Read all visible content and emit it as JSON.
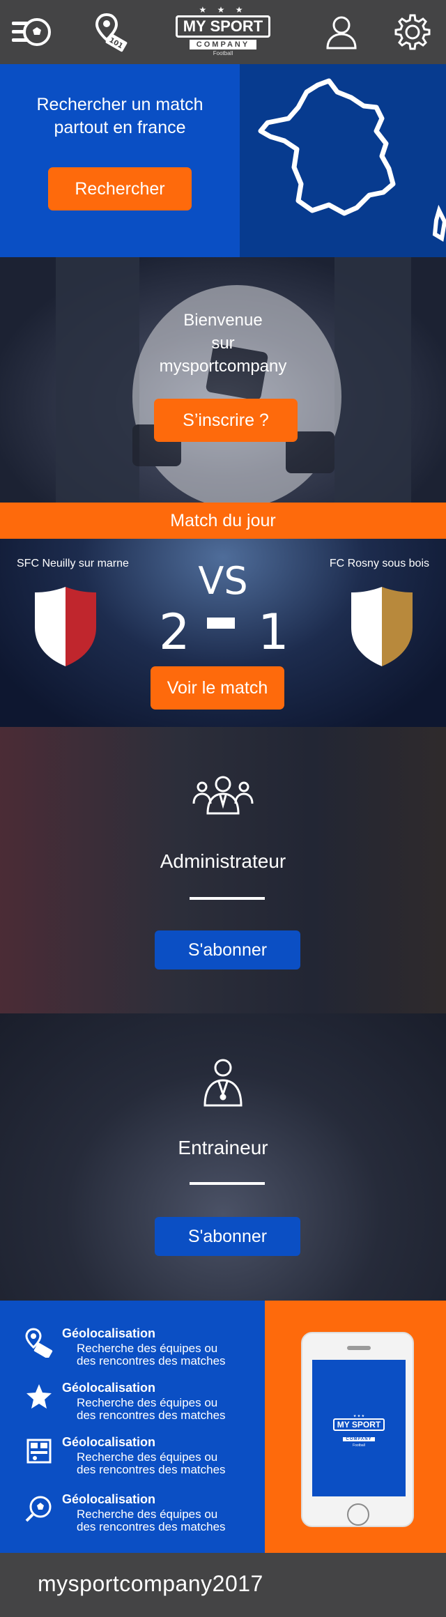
{
  "header": {
    "logo": {
      "stars": "★ ★ ★",
      "name": "MY SPORT",
      "company": "COMPANY",
      "sub": "Football"
    }
  },
  "search": {
    "title": "Rechercher un match partout en france",
    "button": "Rechercher"
  },
  "welcome": {
    "line1": "Bienvenue",
    "line2": "sur",
    "line3": "mysportcompany",
    "button": "S’inscrire ?"
  },
  "match": {
    "bar_title": "Match du jour",
    "home_team": "SFC Neuilly sur marne",
    "away_team": "FC Rosny sous bois",
    "vs": "VS",
    "home_score": "2",
    "away_score": "1",
    "button": "Voir le match",
    "home_colors": [
      "#ffffff",
      "#c0262d"
    ],
    "away_colors": [
      "#ffffff",
      "#b8893c"
    ]
  },
  "subscriptions": [
    {
      "role": "Administrateur",
      "button": "S'abonner"
    },
    {
      "role": "Entraineur",
      "button": "S'abonner"
    }
  ],
  "features": [
    {
      "icon": "map-pin-icon",
      "title": "Géolocalisation",
      "line1": "Recherche des équipes ou",
      "line2": "des  rencontres des matches"
    },
    {
      "icon": "star-icon",
      "title": "Géolocalisation",
      "line1": "Recherche des équipes ou",
      "line2": "des  rencontres des matches"
    },
    {
      "icon": "scoreboard-icon",
      "title": "Géolocalisation",
      "line1": "Recherche des équipes ou",
      "line2": "des  rencontres des matches"
    },
    {
      "icon": "football-search-icon",
      "title": "Géolocalisation",
      "line1": "Recherche des équipes ou",
      "line2": "des  rencontres des matches"
    }
  ],
  "phone_logo": {
    "stars": "★ ★ ★",
    "name": "MY SPORT",
    "company": "COMPANY",
    "sub": "Football"
  },
  "footer": {
    "brand": "mysportcompany2017"
  },
  "colors": {
    "blue": "#0b4fc4",
    "orange": "#fe6a0c",
    "dark": "#444445"
  }
}
